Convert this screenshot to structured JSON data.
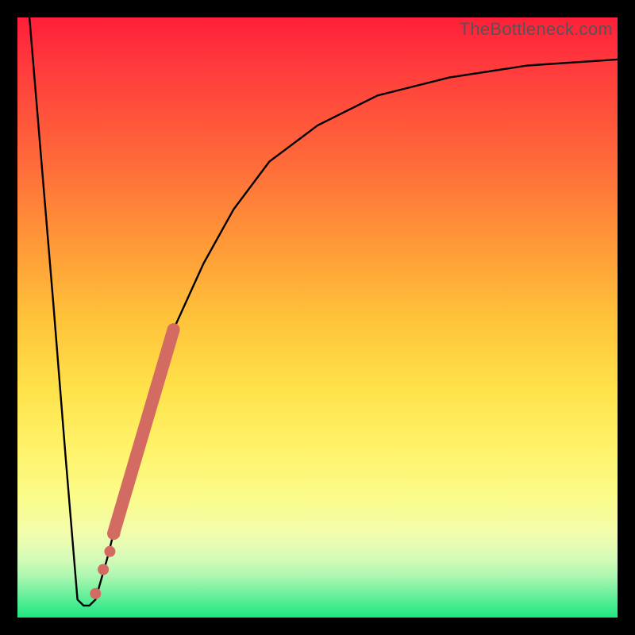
{
  "watermark": "TheBottleneck.com",
  "chart_data": {
    "type": "line",
    "title": "",
    "xlabel": "",
    "ylabel": "",
    "xlim": [
      0,
      100
    ],
    "ylim": [
      0,
      100
    ],
    "grid": false,
    "legend": false,
    "series": [
      {
        "name": "bottleneck-curve",
        "x": [
          2,
          4,
          6,
          8,
          10,
          11,
          12,
          13,
          15,
          18,
          22,
          26,
          31,
          36,
          42,
          50,
          60,
          72,
          85,
          100
        ],
        "y": [
          100,
          76,
          52,
          27,
          3,
          2,
          2,
          3,
          10,
          22,
          36,
          48,
          59,
          68,
          76,
          82,
          87,
          90,
          92,
          93
        ]
      }
    ],
    "highlight_segment": {
      "name": "highlighted-range",
      "x_start": 16,
      "x_end": 26,
      "y_start": 14,
      "y_end": 48
    },
    "highlight_points": {
      "name": "highlighted-dots",
      "x": [
        13,
        14.3,
        15.4,
        16.2
      ],
      "y": [
        4,
        8,
        11,
        14
      ]
    },
    "background_gradient": {
      "top": "#ff1f3a",
      "upper_mid": "#ffb63a",
      "mid": "#fff36a",
      "lower_mid": "#d7fbb8",
      "bottom": "#1ee67f"
    }
  }
}
